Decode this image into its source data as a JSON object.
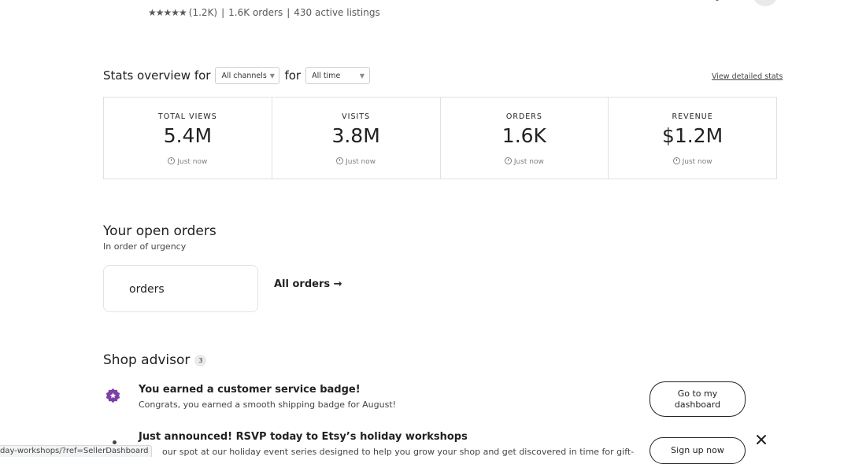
{
  "header": {
    "rating_count": "(1.2K)",
    "orders": "1.6K orders",
    "listings": "430 active listings",
    "separator": "|"
  },
  "stats": {
    "title_prefix": "Stats overview for",
    "channel_select": "All channels",
    "for_label": "for",
    "time_select": "All time",
    "detail_link": "View detailed stats",
    "cards": [
      {
        "label": "TOTAL VIEWS",
        "value": "5.4M",
        "time": "Just now"
      },
      {
        "label": "VISITS",
        "value": "3.8M",
        "time": "Just now"
      },
      {
        "label": "ORDERS",
        "value": "1.6K",
        "time": "Just now"
      },
      {
        "label": "REVENUE",
        "value": "$1.2M",
        "time": "Just now"
      }
    ]
  },
  "open_orders": {
    "title": "Your open orders",
    "subtitle": "In order of urgency",
    "card_text": "orders",
    "all_orders_link": "All orders →"
  },
  "advisor": {
    "title": "Shop advisor",
    "count": "3",
    "items": [
      {
        "title": "You earned a customer service badge!",
        "desc": "Congrats, you earned a smooth shipping badge for August!",
        "button": "Go to my dashboard"
      },
      {
        "title": "Just announced! RSVP today to Etsy’s holiday workshops",
        "desc": "our spot at our holiday event series designed to help you grow your shop and get discovered in time for gift-",
        "button": "Sign up now"
      }
    ]
  },
  "statusbar": {
    "url": "day-workshops/?ref=SellerDashboard"
  },
  "colors": {
    "accent_purple": "#7b3fa6",
    "text": "#222222",
    "border": "#e1e1e1"
  }
}
